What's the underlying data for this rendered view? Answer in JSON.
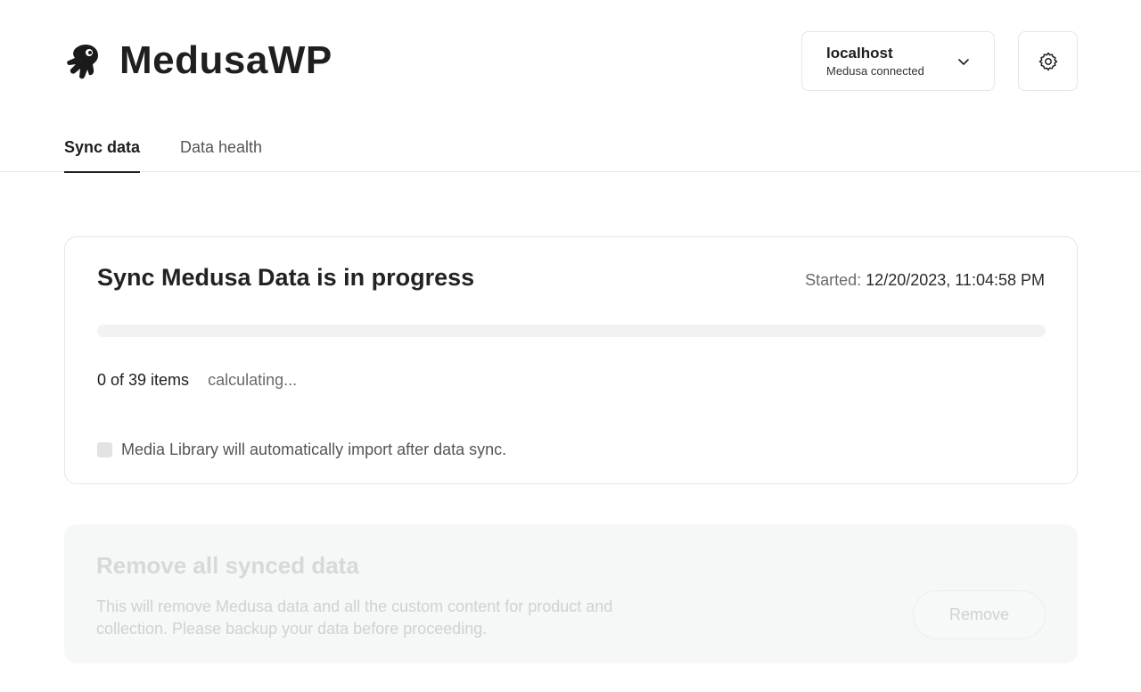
{
  "header": {
    "brand_name": "MedusaWP",
    "logo_icon": "medusa-jellyfish-logo",
    "site_select": {
      "host": "localhost",
      "status": "Medusa connected",
      "icon": "chevron-down-icon"
    },
    "settings_icon": "gear-icon"
  },
  "tabs": [
    {
      "label": "Sync data",
      "active": true
    },
    {
      "label": "Data health",
      "active": false
    }
  ],
  "sync": {
    "title": "Sync Medusa Data is in progress",
    "started_label": "Started:",
    "started_value": "12/20/2023, 11:04:58 PM",
    "progress_fraction": 0,
    "count_text": "0 of 39 items",
    "eta_text": "calculating...",
    "media_note": "Media Library will automatically import after data sync."
  },
  "remove": {
    "title": "Remove all synced data",
    "description": "This will remove Medusa data and all the custom content for product and collection. Please backup your data before proceeding.",
    "button_label": "Remove",
    "disabled": true
  },
  "colors": {
    "primary_text": "#1d1d1f",
    "border": "#e6e6e6",
    "progress_track": "#f1f3f3",
    "disabled_text": "#cfd2d2",
    "disabled_bg": "#f6f7f7"
  }
}
